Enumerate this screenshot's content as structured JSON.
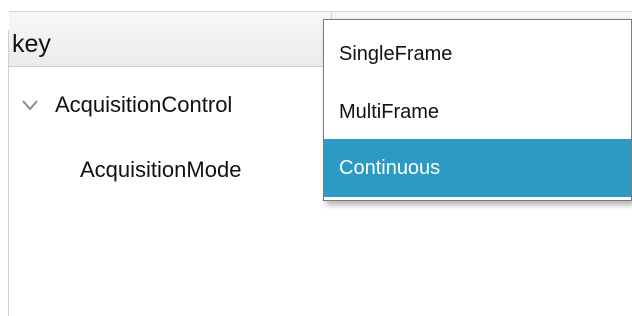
{
  "header": {
    "column_label": "key"
  },
  "tree": {
    "parent": {
      "label": "AcquisitionControl",
      "expanded": true,
      "icon": "chevron-down-icon"
    },
    "child": {
      "label": "AcquisitionMode"
    }
  },
  "dropdown": {
    "options": [
      {
        "label": "SingleFrame",
        "selected": false
      },
      {
        "label": "MultiFrame",
        "selected": false
      },
      {
        "label": "Continuous",
        "selected": true
      }
    ],
    "highlight_color": "#2b9ac4"
  }
}
